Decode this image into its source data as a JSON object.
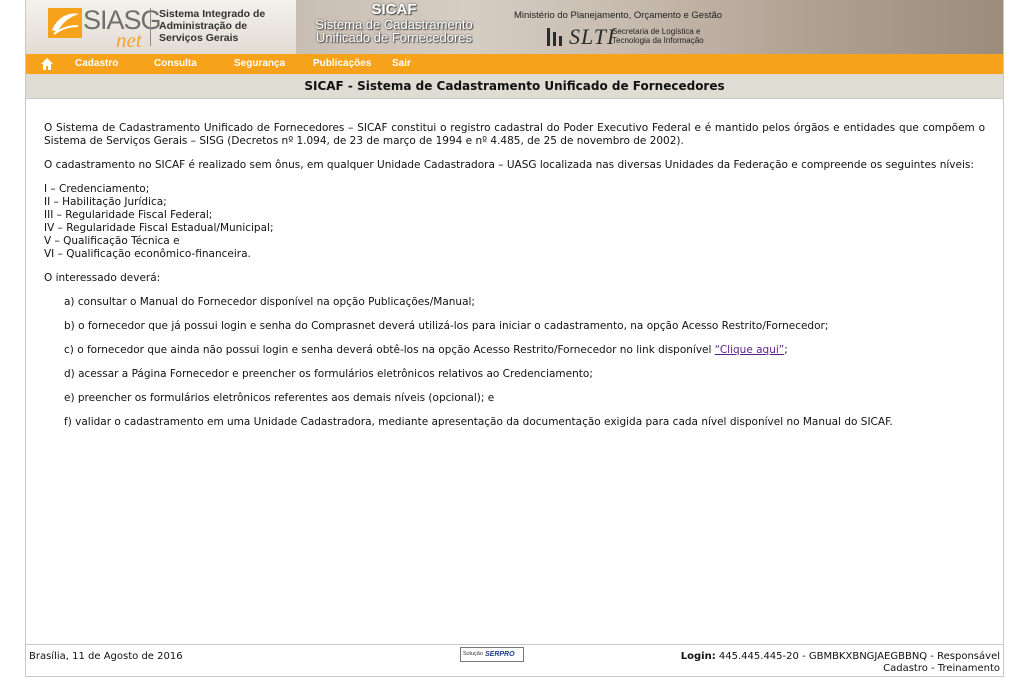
{
  "header": {
    "logo_text": "SIASG",
    "logo_suffix": "net",
    "logo_desc": "Sistema Integrado de\nAdministração de\nServiços Gerais",
    "sicaf_title": "SICAF",
    "sicaf_sub1": "Sistema de Cadastramento",
    "sicaf_sub2": "Unificado de Fornecedores",
    "ministry": "Ministério do Planejamento, Orçamento e Gestão",
    "slti_logo": "SLTI",
    "slti_desc": "Secretaria de Logística e\nTecnologia da Informação"
  },
  "nav": {
    "home_icon": "home-icon",
    "items": [
      "Cadastro",
      "Consulta",
      "Segurança",
      "Publicações",
      "Sair"
    ]
  },
  "page_title": "SICAF - Sistema de Cadastramento Unificado de Fornecedores",
  "content": {
    "p1": "O Sistema de Cadastramento Unificado de Fornecedores – SICAF constitui o registro cadastral do Poder Executivo Federal e é mantido pelos órgãos e entidades que compõem o Sistema de Serviços Gerais – SISG (Decretos nº 1.094, de 23 de março de 1994 e nº 4.485, de 25 de novembro de 2002).",
    "p2": "O cadastramento no SICAF é realizado sem ônus, em qualquer Unidade Cadastradora – UASG localizada nas diversas Unidades da Federação e compreende os seguintes níveis:",
    "levels": [
      "I – Credenciamento;",
      "II – Habilitação Jurídica;",
      "III – Regularidade Fiscal Federal;",
      "IV – Regularidade Fiscal Estadual/Municipal;",
      "V – Qualificação Técnica e",
      "VI – Qualificação econômico-financeira."
    ],
    "p3": "O interessado deverá:",
    "step_a": "a) consultar o Manual do Fornecedor disponível na opção Publicações/Manual;",
    "step_b": "b) o fornecedor que já possui login e senha do Comprasnet deverá utilizá-los para iniciar o cadastramento, na opção Acesso Restrito/Fornecedor;",
    "step_c_pre": "c) o fornecedor que ainda não possui login e senha deverá obtê-los na opção Acesso Restrito/Fornecedor no link disponível ",
    "step_c_link": "“Clique aqui”",
    "step_c_post": ";",
    "step_d": "d) acessar a Página Fornecedor e preencher os formulários eletrônicos relativos ao Credenciamento;",
    "step_e": "e) preencher os formulários eletrônicos referentes aos demais níveis (opcional); e",
    "step_f": "f) validar o cadastramento em uma Unidade Cadastradora, mediante apresentação da documentação exigida para cada nível disponível no Manual do SICAF."
  },
  "footer": {
    "date": "Brasília, 11 de Agosto de 2016",
    "badge_sol": "Solução",
    "badge_serpro": "SERPRO",
    "login_label": "Login:",
    "login_value": " 445.445.445-20 - GBMBKXBNGJAEGBBNQ - Responsável",
    "login_line2": "Cadastro - Treinamento"
  },
  "colors": {
    "nav_bg": "#f7a21b",
    "titlebar_bg": "#dedcd3",
    "link": "#5b1f8a"
  }
}
